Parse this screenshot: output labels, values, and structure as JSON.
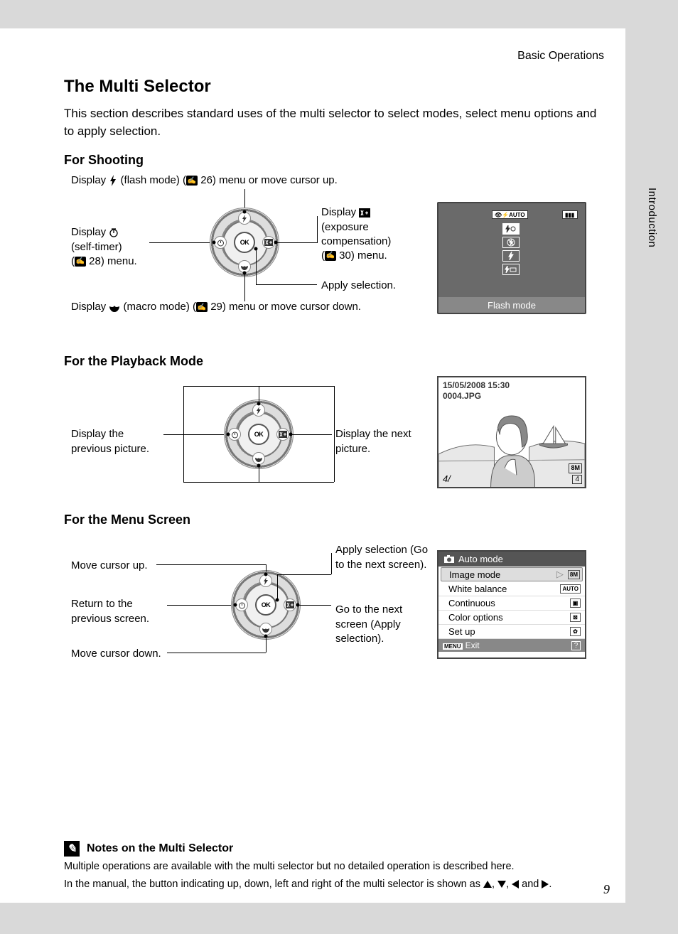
{
  "header": {
    "section": "Basic Operations",
    "side_tab": "Introduction"
  },
  "title": "The Multi Selector",
  "intro": "This section describes standard uses of the multi selector to select modes, select menu options and to apply selection.",
  "shooting": {
    "heading": "For Shooting",
    "up_pre": "Display ",
    "up_post": " (flash mode) (",
    "up_ref": "26",
    "up_tail": ") menu or move cursor up.",
    "left_pre": "Display ",
    "left_mid": " (self-timer) (",
    "left_ref": "28",
    "left_tail": ") menu.",
    "right_pre": "Display ",
    "right_mid": " (exposure compensation) (",
    "right_ref": "30",
    "right_tail": ") menu.",
    "apply": "Apply selection.",
    "down_pre": "Display ",
    "down_mid": " (macro mode) (",
    "down_ref": "29",
    "down_tail": ") menu or move cursor down.",
    "screen": {
      "status_auto": "⚡AUTO",
      "footer": "Flash mode"
    }
  },
  "playback": {
    "heading": "For the Playback Mode",
    "left": "Display the previous picture.",
    "right": "Display the next picture.",
    "screen": {
      "date": "15/05/2008 15:30",
      "file": "0004.JPG",
      "counter": "4/",
      "total": "4",
      "size": "8M"
    }
  },
  "menu": {
    "heading": "For the Menu Screen",
    "up": "Move cursor up.",
    "left": "Return to the previous screen.",
    "down": "Move cursor down.",
    "ok": "Apply selection (Go to the next screen).",
    "right": "Go to the next screen (Apply selection).",
    "screen": {
      "title": "Auto mode",
      "items": [
        {
          "label": "Image mode",
          "badge": "8M",
          "highlight": true
        },
        {
          "label": "White balance",
          "badge": "AUTO"
        },
        {
          "label": "Continuous",
          "badge": "▣"
        },
        {
          "label": "Color options",
          "badge": "⊠"
        },
        {
          "label": "Set up",
          "badge": "✿"
        }
      ],
      "footer_chip": "MENU",
      "footer_label": "Exit",
      "footer_help": "?"
    }
  },
  "notes": {
    "heading": "Notes on the Multi Selector",
    "p1": "Multiple operations are available with the multi selector but no detailed operation is described here.",
    "p2_pre": "In the manual, the button indicating up, down, left and right of the multi selector is shown as ",
    "p2_and": " and ",
    "p2_end": "."
  },
  "ok_label": "OK",
  "page_number": "9"
}
